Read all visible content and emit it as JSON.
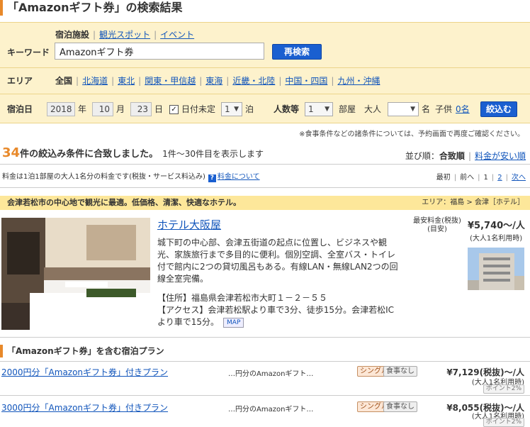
{
  "page": {
    "title": "「Amazonギフト券」の検索結果"
  },
  "search": {
    "keyword_label": "キーワード",
    "tabs": [
      "宿泊施設",
      "観光スポット",
      "イベント"
    ],
    "keyword_value": "Amazonギフト券",
    "research_button": "再検索",
    "area_label": "エリア",
    "areas": [
      "全国",
      "北海道",
      "東北",
      "関東・甲信越",
      "東海",
      "近畿・北陸",
      "中国・四国",
      "九州・沖縄"
    ],
    "date_label": "宿泊日",
    "year": "2018",
    "year_unit": "年",
    "month": "10",
    "month_unit": "月",
    "day": "23",
    "day_unit": "日",
    "date_undecided": "日付未定",
    "nights": "1",
    "nights_unit": "泊",
    "people_label": "人数等",
    "rooms": "1",
    "rooms_unit": "部屋",
    "adults_label": "大人",
    "adults_value": "",
    "adults_unit": "名",
    "children_label": "子供",
    "children_value": "0名",
    "filter_button": "絞込む"
  },
  "notice": "※食事条件などの諸条件については、予約画面で再度ご確認ください。",
  "results": {
    "count": "34",
    "count_text": "件の絞込み条件に合致しました。",
    "range_text": "1件〜30件目を表示します",
    "sort_label": "並び順：",
    "sort_active": "合致順",
    "sort_option": "料金が安い順"
  },
  "fee_note": "料金は1泊1部屋の大人1名分の料金です(税抜・サービス料込み)",
  "fee_help_link": "料金について",
  "pager": {
    "first": "最初",
    "prev": "前へ",
    "p1": "1",
    "p2": "2",
    "next": "次へ"
  },
  "hotel": {
    "catch": "会津若松市の中心地で観光に最適。低価格、清潔、快適なホテル。",
    "area": "エリア：福島 > 会津［ホテル］",
    "name": "ホテル大阪屋",
    "description": "城下町の中心部、会津五街道の起点に位置し、ビジネスや観光、家族旅行まで多目的に便利。個別空調、全室バス・トイレ付で館内に2つの貸切風呂もある。有線LAN・無線LAN2つの回線全室完備。",
    "address": "【住所】福島県会津若松市大町１－２－５５",
    "access": "【アクセス】会津若松駅より車で3分、徒歩15分。会津若松ICより車で15分。",
    "map_button": "MAP",
    "price_label_1": "最安料金(税抜)",
    "price_label_2": "(目安)",
    "price": "¥5,740〜/人",
    "price_sub": "(大人1名利用時)"
  },
  "plans": {
    "title": "「Amazonギフト券」を含む宿泊プラン",
    "items": [
      {
        "name": "2000円分「Amazonギフト券」付きプラン",
        "desc": "…円分のAmazonギフト…",
        "tag1": "シングル",
        "tag2": "食事なし",
        "price": "¥7,129(税抜)〜/人",
        "sub": "(大人1名利用時)",
        "point": "ポイント2%"
      },
      {
        "name": "3000円分「Amazonギフト券」付きプラン",
        "desc": "…円分のAmazonギフト…",
        "tag1": "シングル",
        "tag2": "食事なし",
        "price": "¥8,055(税抜)〜/人",
        "sub": "(大人1名利用時)",
        "point": "ポイント2%"
      }
    ]
  }
}
